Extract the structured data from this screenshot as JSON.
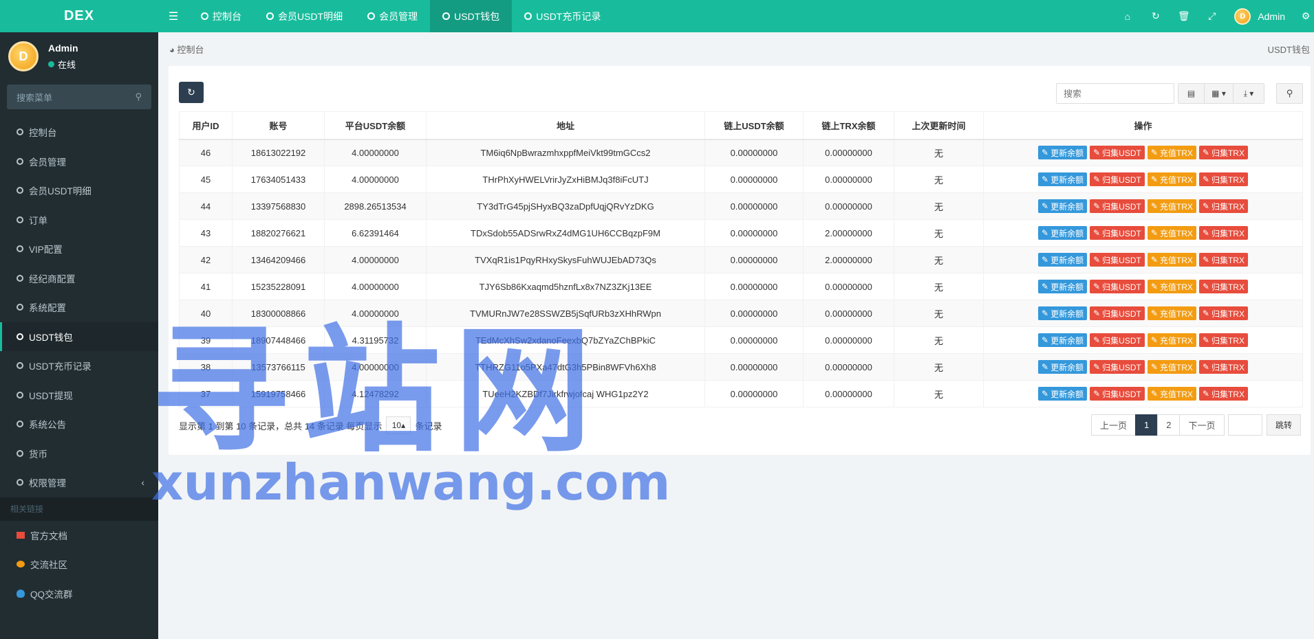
{
  "app": {
    "logo": "DEX"
  },
  "topnav": {
    "tabs": [
      {
        "label": "控制台"
      },
      {
        "label": "会员USDT明细"
      },
      {
        "label": "会员管理"
      },
      {
        "label": "USDT钱包"
      },
      {
        "label": "USDT充币记录"
      }
    ],
    "user": "Admin",
    "avatar_text": "D"
  },
  "sidebar": {
    "user": {
      "name": "Admin",
      "status": "在线"
    },
    "search_placeholder": "搜索菜单",
    "items": [
      {
        "label": "控制台"
      },
      {
        "label": "会员管理"
      },
      {
        "label": "会员USDT明细"
      },
      {
        "label": "订单"
      },
      {
        "label": "VIP配置"
      },
      {
        "label": "经纪商配置"
      },
      {
        "label": "系统配置"
      },
      {
        "label": "USDT钱包"
      },
      {
        "label": "USDT充币记录"
      },
      {
        "label": "USDT提现"
      },
      {
        "label": "系统公告"
      },
      {
        "label": "货币"
      },
      {
        "label": "权限管理"
      }
    ],
    "section_header": "相关链接",
    "links": [
      {
        "label": "官方文档",
        "color": "#e74c3c"
      },
      {
        "label": "交流社区",
        "color": "#f39c12"
      },
      {
        "label": "QQ交流群",
        "color": "#3498db"
      }
    ]
  },
  "breadcrumb": {
    "home": "控制台",
    "current": "USDT钱包"
  },
  "toolbar": {
    "search_placeholder": "搜索"
  },
  "table": {
    "headers": [
      "用户ID",
      "账号",
      "平台USDT余额",
      "地址",
      "链上USDT余额",
      "链上TRX余额",
      "上次更新时间",
      "操作"
    ],
    "actions": [
      "更新余额",
      "归集USDT",
      "充值TRX",
      "归集TRX"
    ],
    "rows": [
      [
        "46",
        "18613022192",
        "4.00000000",
        "TM6iq6NpBwrazmhxppfMeiVkt99tmGCcs2",
        "0.00000000",
        "0.00000000",
        "无"
      ],
      [
        "45",
        "17634051433",
        "4.00000000",
        "THrPhXyHWELVrirJyZxHiBMJq3f8iFcUTJ",
        "0.00000000",
        "0.00000000",
        "无"
      ],
      [
        "44",
        "13397568830",
        "2898.26513534",
        "TY3dTrG45pjSHyxBQ3zaDpfUqjQRvYzDKG",
        "0.00000000",
        "0.00000000",
        "无"
      ],
      [
        "43",
        "18820276621",
        "6.62391464",
        "TDxSdob55ADSrwRxZ4dMG1UH6CCBqzpF9M",
        "0.00000000",
        "2.00000000",
        "无"
      ],
      [
        "42",
        "13464209466",
        "4.00000000",
        "TVXqR1is1PqyRHxySkysFuhWUJEbAD73Qs",
        "0.00000000",
        "2.00000000",
        "无"
      ],
      [
        "41",
        "15235228091",
        "4.00000000",
        "TJY6Sb86Kxaqmd5hznfLx8x7NZ3ZKj13EE",
        "0.00000000",
        "0.00000000",
        "无"
      ],
      [
        "40",
        "18300008866",
        "4.00000000",
        "TVMURnJW7e28SSWZB5jSqfURb3zXHhRWpn",
        "0.00000000",
        "0.00000000",
        "无"
      ],
      [
        "39",
        "18907448466",
        "4.31195732",
        "TEdMcXhSw2xdanoFeexbQ7bZYaZChBPkiC",
        "0.00000000",
        "0.00000000",
        "无"
      ],
      [
        "38",
        "13573766115",
        "4.00000000",
        "TTHRZG11o5PXa47dtG3h5PBin8WFVh6Xh8",
        "0.00000000",
        "0.00000000",
        "无"
      ],
      [
        "37",
        "15919758466",
        "4.12478292",
        "TUeeH2KZBDf7Jirkfrwjofcaj WHG1pz2Y2",
        "0.00000000",
        "0.00000000",
        "无"
      ]
    ]
  },
  "pagination": {
    "info_prefix": "显示第 1 到第 10 条记录，总共 14 条记录 每页显示",
    "page_size": "10",
    "info_suffix": "条记录",
    "prev": "上一页",
    "pages": [
      "1",
      "2"
    ],
    "next": "下一页",
    "jump": "跳转"
  },
  "watermark": {
    "cn": "寻站网",
    "en": "xunzhanwang.com"
  }
}
